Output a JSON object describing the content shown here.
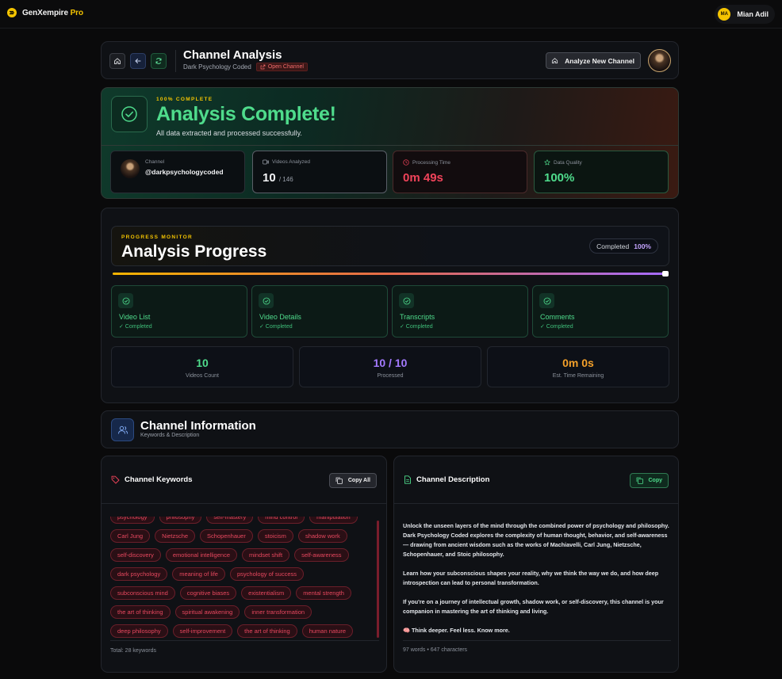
{
  "app": {
    "brand": "GenXempire",
    "brand_suffix": "Pro",
    "user_initials": "MA",
    "user_name": "Mian Adil"
  },
  "header": {
    "title": "Channel Analysis",
    "channel_name": "Dark Psychology Coded",
    "open_channel_label": "Open Channel",
    "analyze_new_label": "Analyze New Channel"
  },
  "complete": {
    "kicker": "100% COMPLETE",
    "title": "Analysis Complete!",
    "subtitle": "All data extracted and processed successfully.",
    "channel_label": "Channel",
    "channel_handle": "@darkpsychologycoded",
    "videos_label": "Videos Analyzed",
    "videos_value": "10",
    "videos_total": "/ 146",
    "time_label": "Processing Time",
    "time_value": "0m 49s",
    "quality_label": "Data Quality",
    "quality_value": "100%"
  },
  "progress": {
    "kicker": "PROGRESS MONITOR",
    "title": "Analysis Progress",
    "chip_label": "Completed",
    "chip_value": "100%",
    "fraction": 1.0,
    "steps": [
      {
        "name": "Video List",
        "status": "✓ Completed"
      },
      {
        "name": "Video Details",
        "status": "✓ Completed"
      },
      {
        "name": "Transcripts",
        "status": "✓ Completed"
      },
      {
        "name": "Comments",
        "status": "✓ Completed"
      }
    ],
    "metrics": [
      {
        "value": "10",
        "label": "Videos Count"
      },
      {
        "value": "10 / 10",
        "label": "Processed"
      },
      {
        "value": "0m 0s",
        "label": "Est. Time Remaining"
      }
    ]
  },
  "info": {
    "title": "Channel Information",
    "subtitle": "Keywords & Description"
  },
  "keywords": {
    "title": "Channel Keywords",
    "copy_all_label": "Copy All",
    "items": [
      "psychology",
      "philosophy",
      "self-mastery",
      "mind control",
      "manipulation",
      "Carl Jung",
      "Nietzsche",
      "Schopenhauer",
      "stoicism",
      "shadow work",
      "self-discovery",
      "emotional intelligence",
      "mindset shift",
      "self-awareness",
      "dark psychology",
      "meaning of life",
      "psychology of success",
      "subconscious mind",
      "cognitive biases",
      "existentialism",
      "mental strength",
      "the art of thinking",
      "spiritual awakening",
      "inner transformation",
      "deep philosophy",
      "self-improvement",
      "the art of thinking",
      "human nature"
    ],
    "total": "Total: 28 keywords"
  },
  "description": {
    "title": "Channel Description",
    "copy_label": "Copy",
    "paragraphs": [
      "Unlock the unseen layers of the mind through the combined power of psychology and philosophy. Dark Psychology Coded explores the complexity of human thought, behavior, and self-awareness — drawing from ancient wisdom such as the works of Machiavelli, Carl Jung, Nietzsche, Schopenhauer, and Stoic philosophy.",
      "Learn how your subconscious shapes your reality, why we think the way we do, and how deep introspection can lead to personal transformation.",
      "If you're on a journey of intellectual growth, shadow work, or self-discovery, this channel is your companion in mastering the art of thinking and living.",
      "🧠 Think deeper. Feel less. Know more."
    ],
    "meta": "97 words • 647 characters"
  }
}
